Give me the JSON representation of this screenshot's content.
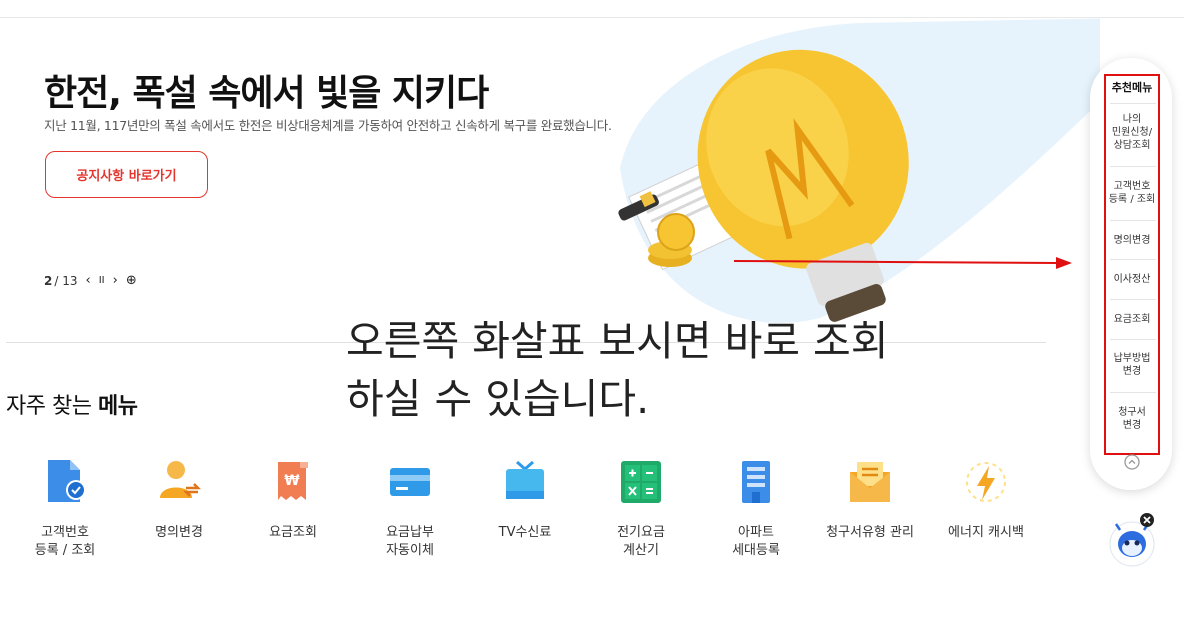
{
  "hero": {
    "title": "한전, 폭설 속에서 빛을 지키다",
    "description": "지난 11월, 117년만의 폭설 속에서도 한전은 비상대응체계를 가동하여 안전하고 신속하게 복구를 완료했습니다.",
    "notice_button": "공지사항 바로가기"
  },
  "pager": {
    "current": "2",
    "total": "/ 13",
    "prev": "‹",
    "pause": "II",
    "next": "›",
    "more": "⊕"
  },
  "overlay": {
    "line1": "오른쪽 화살표 보시면 바로 조회",
    "line2": "하실 수 있습니다."
  },
  "faq": {
    "title_prefix": "자주 찾는 ",
    "title_bold": "메뉴",
    "items": [
      {
        "label": "고객번호\n등록 / 조회",
        "icon": "document-check-icon"
      },
      {
        "label": "명의변경",
        "icon": "person-transfer-icon"
      },
      {
        "label": "요금조회",
        "icon": "receipt-won-icon"
      },
      {
        "label": "요금납부\n자동이체",
        "icon": "credit-card-icon"
      },
      {
        "label": "TV수신료",
        "icon": "tv-icon"
      },
      {
        "label": "전기요금\n계산기",
        "icon": "calculator-icon"
      },
      {
        "label": "아파트\n세대등록",
        "icon": "apartment-icon"
      },
      {
        "label": "청구서유형 관리",
        "icon": "envelope-icon"
      },
      {
        "label": "에너지 캐시백",
        "icon": "energy-cashback-icon"
      }
    ]
  },
  "quick_menu": {
    "title": "추천메뉴",
    "items": [
      "나의\n민원신청/\n상담조회",
      "고객번호\n등록 / 조회",
      "명의변경",
      "이사정산",
      "요금조회",
      "납부방법\n변경",
      "청구서\n변경"
    ]
  },
  "colors": {
    "accent_red": "#e3362f",
    "annotation_red": "#e01010",
    "icon_blue": "#3b8de8",
    "icon_orange": "#f5a623",
    "icon_green": "#27ae60",
    "bulb_yellow": "#f7c531"
  }
}
